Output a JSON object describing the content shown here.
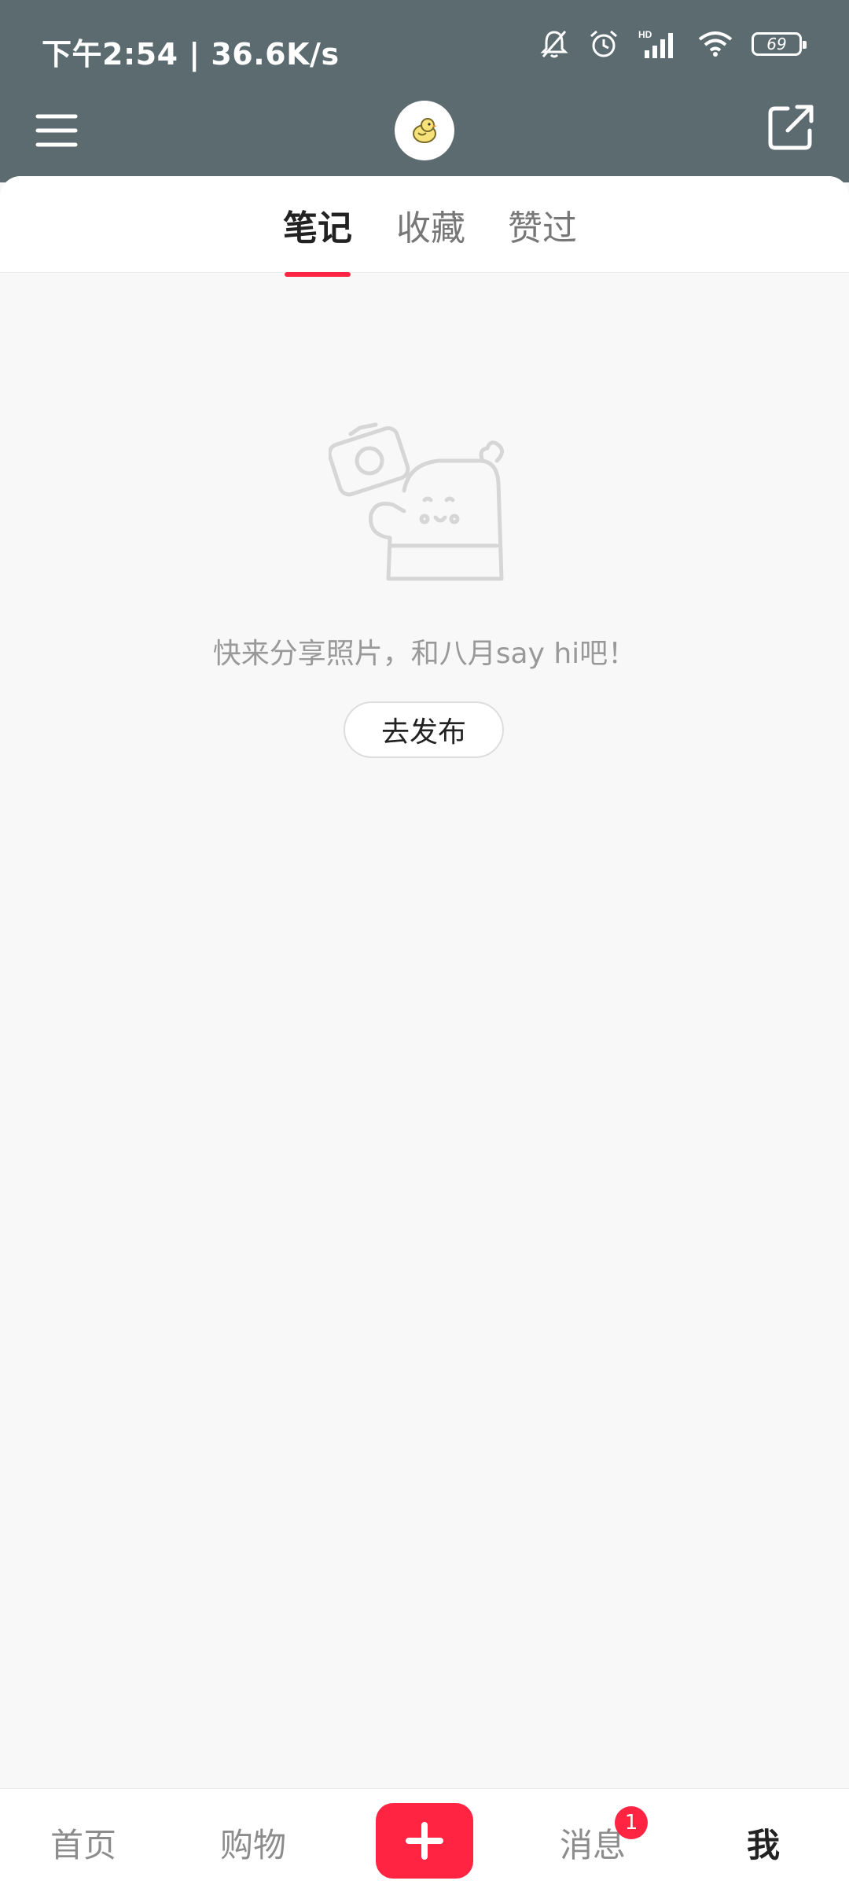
{
  "status_bar": {
    "time_speed": "下午2:54 | 36.6K/s",
    "battery": "69"
  },
  "header": {
    "menu_icon": "hamburger-menu-icon",
    "avatar_icon": "bird-avatar-icon",
    "share_icon": "share-external-icon"
  },
  "tabs": [
    {
      "label": "笔记",
      "active": true
    },
    {
      "label": "收藏",
      "active": false
    },
    {
      "label": "赞过",
      "active": false
    }
  ],
  "empty_state": {
    "illustration": "camera-character-illustration",
    "message": "快来分享照片，和八月say hi吧！",
    "button_label": "去发布"
  },
  "bottom_nav": {
    "items": [
      {
        "label": "首页"
      },
      {
        "label": "购物"
      },
      {
        "label": "消息",
        "badge": "1"
      },
      {
        "label": "我",
        "active": true
      }
    ],
    "plus_icon": "plus-icon"
  },
  "colors": {
    "accent": "#ff2442",
    "header_bg": "#5c6b70"
  }
}
